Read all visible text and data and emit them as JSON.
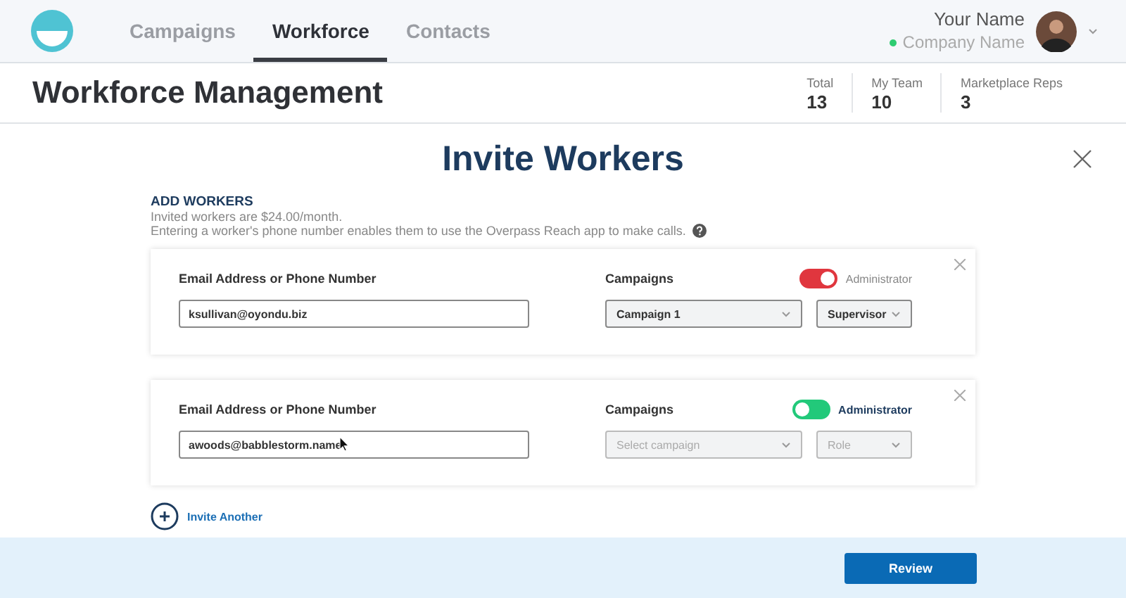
{
  "nav": {
    "tabs": [
      {
        "label": "Campaigns",
        "selected": false
      },
      {
        "label": "Workforce",
        "selected": true
      },
      {
        "label": "Contacts",
        "selected": false
      }
    ]
  },
  "user": {
    "name": "Your Name",
    "company": "Company Name"
  },
  "page_title": "Workforce Management",
  "stats": [
    {
      "label": "Total",
      "value": "13"
    },
    {
      "label": "My Team",
      "value": "10"
    },
    {
      "label": "Marketplace Reps",
      "value": "3"
    }
  ],
  "dialog": {
    "title": "Invite Workers",
    "section": "ADD WORKERS",
    "notes": [
      "Invited workers are $24.00/month.",
      "Entering a worker's phone number enables them to use the Overpass Reach app to make calls."
    ],
    "workers": [
      {
        "email_label": "Email Address or Phone Number",
        "email": "ksullivan@oyondu.biz",
        "campaigns_label": "Campaigns",
        "campaign": {
          "value": "Campaign 1"
        },
        "role": {
          "value": "Supervisor"
        },
        "admin": {
          "label": "Administrator",
          "on": true,
          "color": "#e0363e"
        }
      },
      {
        "email_label": "Email Address or Phone Number",
        "email": "awoods@babblestorm.name",
        "campaigns_label": "Campaigns",
        "campaign": {
          "placeholder": "Select campaign"
        },
        "role": {
          "placeholder": "Role"
        },
        "admin": {
          "label": "Administrator",
          "on": false,
          "color": "#22c97a"
        },
        "pointer": true
      }
    ],
    "invite_another": "Invite Another",
    "review": "Review"
  }
}
